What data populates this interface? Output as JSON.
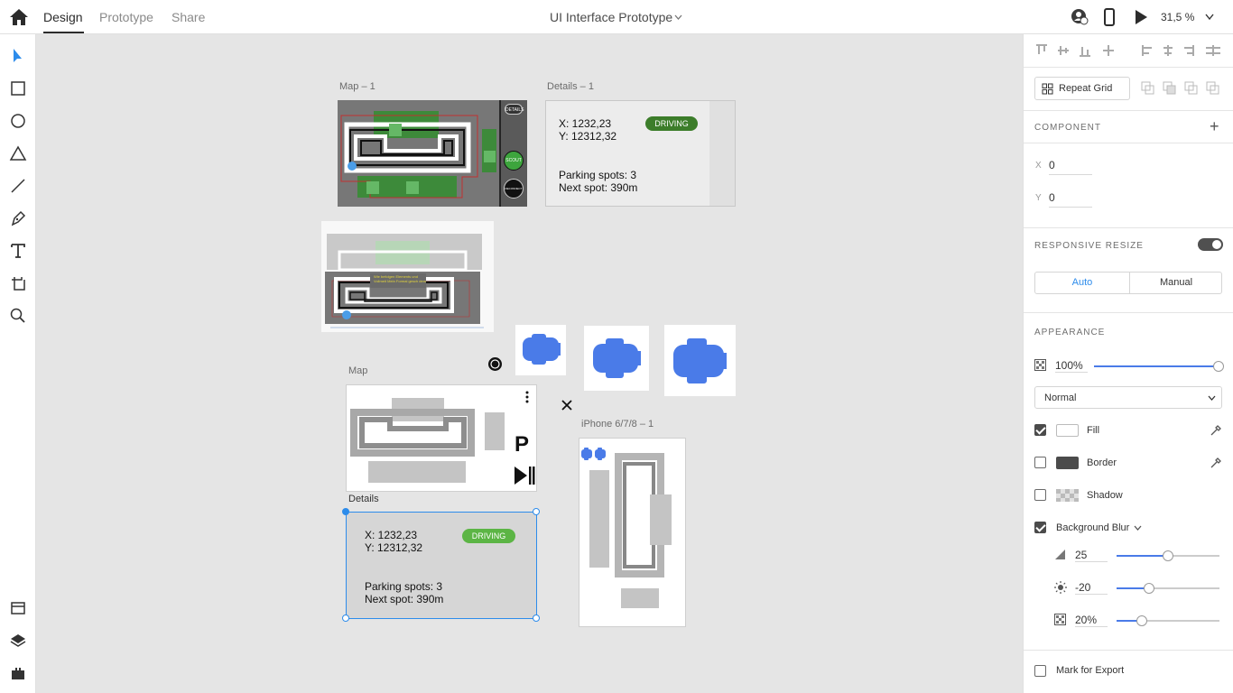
{
  "topbar": {
    "tabs": [
      {
        "label": "Design"
      },
      {
        "label": "Prototype"
      },
      {
        "label": "Share"
      }
    ],
    "doc_title": "UI Interface Prototype",
    "zoom": "31,5 %"
  },
  "canvas": {
    "artboards": {
      "map1": {
        "label": "Map – 1",
        "buttons": [
          "DETAILS",
          "SCOUT",
          "RECONNECT"
        ]
      },
      "details1": {
        "label": "Details – 1",
        "coords": "X: 1232,23\nY: 12312,32",
        "status": "DRIVING",
        "parking": "Parking spots: 3\nNext spot: 390m"
      },
      "sketch": {
        "note": "Wie befolgen Elements und\nVollmeit Mein Formal gesch dem"
      },
      "map": {
        "label": "Map",
        "parking_glyph": "P"
      },
      "details": {
        "label": "Details",
        "coords": "X: 1232,23\nY: 12312,32",
        "status": "DRIVING",
        "parking": "Parking spots: 3\nNext spot: 390m"
      },
      "iphone": {
        "label": "iPhone 6/7/8 – 1"
      }
    },
    "colors": {
      "driving_dark": "#3c7d2a",
      "driving_light": "#5cb545",
      "car_blue": "#4a7be8",
      "selection": "#2d8ceb"
    }
  },
  "panel": {
    "repeat_grid": "Repeat Grid",
    "component": {
      "title": "COMPONENT",
      "add": "+"
    },
    "position": {
      "x_label": "X",
      "x_value": "0",
      "y_label": "Y",
      "y_value": "0"
    },
    "responsive": {
      "title": "RESPONSIVE RESIZE",
      "enabled": true,
      "auto": "Auto",
      "manual": "Manual"
    },
    "appearance": {
      "title": "APPEARANCE",
      "opacity": "100%",
      "opacity_value": 1.0,
      "blend_mode": "Normal",
      "fill": {
        "label": "Fill",
        "checked": true,
        "color": "#ffffff"
      },
      "border": {
        "label": "Border",
        "checked": false,
        "color": "#4b4b4b"
      },
      "shadow": {
        "label": "Shadow",
        "checked": false
      },
      "background_blur": {
        "label": "Background Blur",
        "checked": true,
        "amount": "25",
        "amount_value": 0.5,
        "brightness": "-20",
        "brightness_value": 0.3,
        "opacity": "20%",
        "opacity_value": 0.2
      }
    },
    "export": {
      "label": "Mark for Export",
      "checked": false
    }
  }
}
